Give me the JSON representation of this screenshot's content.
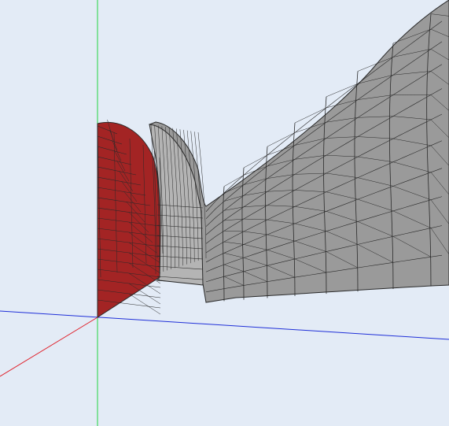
{
  "viewport": {
    "background": "#e3ebf6"
  },
  "axes": {
    "x_color": "#e0202a",
    "y_color": "#20d640",
    "z_color": "#1f2fd8"
  },
  "mesh": {
    "surface_color": "#9a9a9a",
    "surface_light": "#b4b4b4",
    "cut_face_color": "#a32424",
    "edge_color": "#2a2a2a"
  }
}
